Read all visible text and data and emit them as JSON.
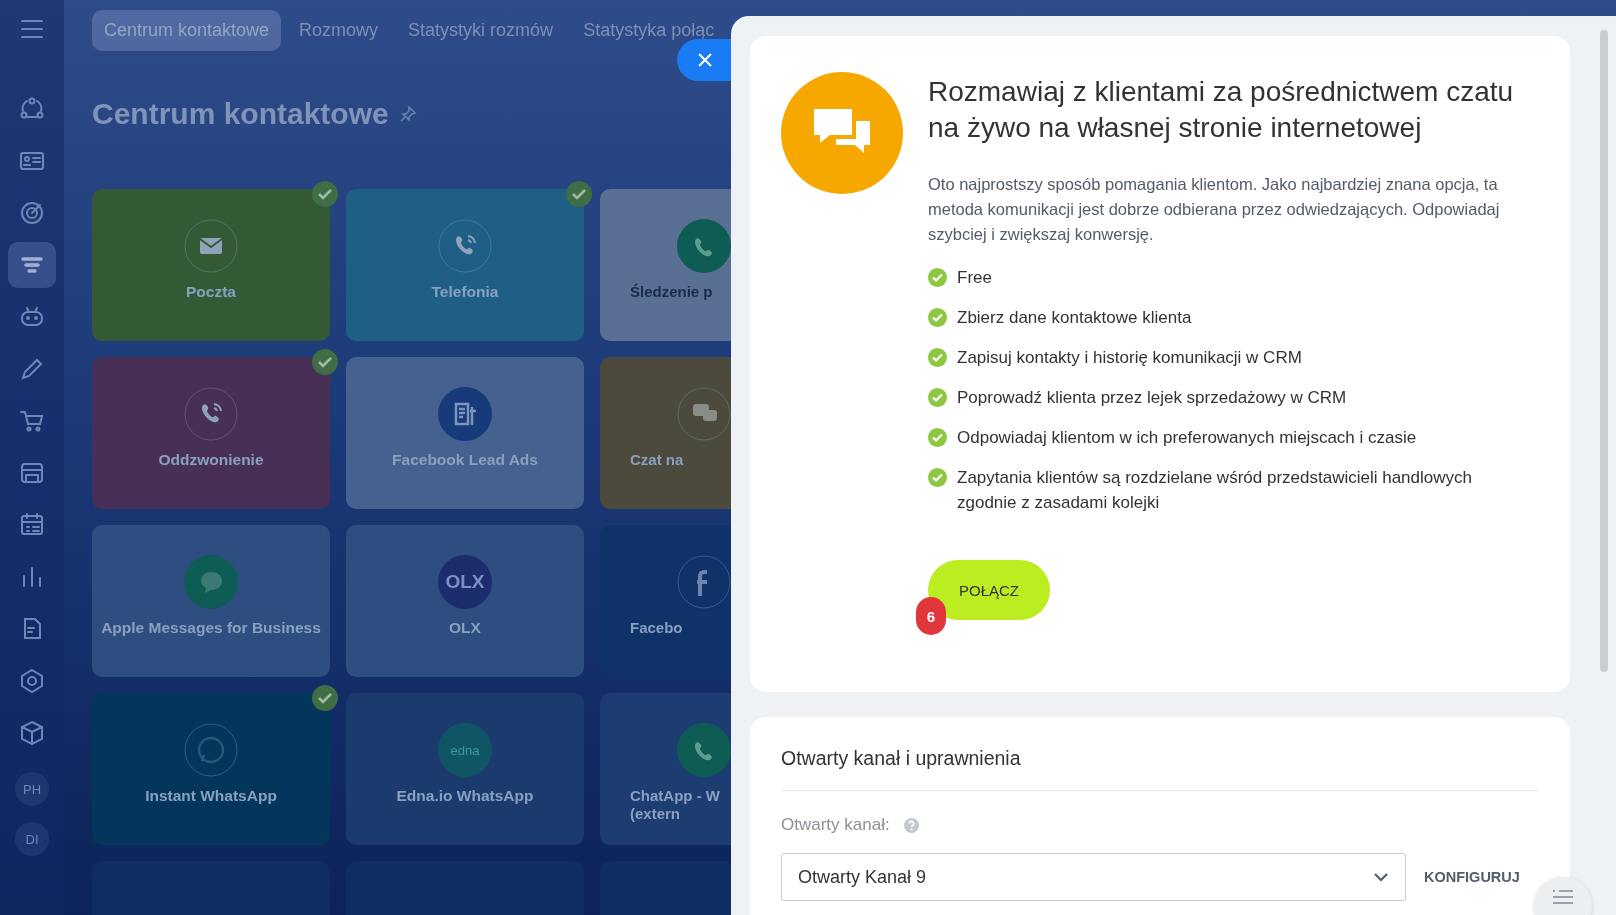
{
  "sidebar": {
    "items": [
      {
        "selected": false
      },
      {
        "selected": false
      },
      {
        "selected": false
      },
      {
        "selected": true
      },
      {
        "selected": false
      },
      {
        "selected": false
      },
      {
        "selected": false
      },
      {
        "selected": false
      },
      {
        "selected": false
      },
      {
        "selected": false
      },
      {
        "selected": false
      },
      {
        "selected": false
      },
      {
        "selected": false
      }
    ],
    "avatars": [
      "PH",
      "DI"
    ]
  },
  "tabs": [
    {
      "label": "Centrum kontaktowe",
      "selected": true
    },
    {
      "label": "Rozmowy",
      "selected": false
    },
    {
      "label": "Statystyki rozmów",
      "selected": false
    },
    {
      "label": "Statystyka połąc",
      "selected": false
    }
  ],
  "page_title": "Centrum kontaktowe",
  "tiles": [
    {
      "label": "Poczta",
      "color": "#345a35",
      "connected": true
    },
    {
      "label": "Telefonia",
      "color": "#1f5f86",
      "connected": true
    },
    {
      "label": "Śledzenie p",
      "color": "#5a6f94",
      "connected": false
    },
    {
      "label": "Oddzwonienie",
      "color": "#472f55",
      "connected": true
    },
    {
      "label": "Facebook Lead Ads",
      "color": "#45618f",
      "connected": false
    },
    {
      "label": "Czat na",
      "color": "#4b4a3d",
      "connected": false
    },
    {
      "label": "Apple Messages for Business",
      "color": "#2e4d80",
      "connected": false
    },
    {
      "label": "OLX",
      "color": "#2e4d80",
      "logo_text": "OLX",
      "connected": false
    },
    {
      "label": "Facebo",
      "color": "#0f3268",
      "connected": false
    },
    {
      "label": "Instant WhatsApp",
      "color": "#03365a",
      "connected": true
    },
    {
      "label": "Edna.io WhatsApp",
      "color": "#1b3b6f",
      "logo_text": "edna",
      "connected": false
    },
    {
      "label": "ChatApp - W",
      "label_line2": "(extern",
      "color": "#1d3c72",
      "connected": false
    },
    {
      "color": "#0f2d62",
      "connected": false
    },
    {
      "color": "#0f2d62",
      "connected": false
    },
    {
      "color": "#0f2d62",
      "connected": false
    }
  ],
  "panel": {
    "intro": {
      "title": "Rozmawiaj z klientami za pośrednictwem czatu na żywo na własnej stronie internetowej",
      "description": "Oto najprostszy sposób pomagania klientom. Jako najbardziej znana opcja, ta metoda komunikacji jest dobrze odbierana przez odwiedzających. Odpowiadaj szybciej i zwiększaj konwersję.",
      "features": [
        "Free",
        "Zbierz dane kontaktowe klienta",
        "Zapisuj kontakty i historię komunikacji w CRM",
        "Poprowadź klienta przez lejek sprzedażowy w CRM",
        "Odpowiadaj klientom w ich preferowanych miejscach i czasie",
        "Zapytania klientów są rozdzielane wśród przedstawicieli handlowych zgodnie z zasadami kolejki"
      ],
      "button": "POŁĄCZ",
      "badge": "6"
    },
    "settings": {
      "title": "Otwarty kanał i uprawnienia",
      "field_label": "Otwarty kanał:",
      "select_value": "Otwarty Kanał 9",
      "link": "KONFIGURUJ"
    }
  }
}
